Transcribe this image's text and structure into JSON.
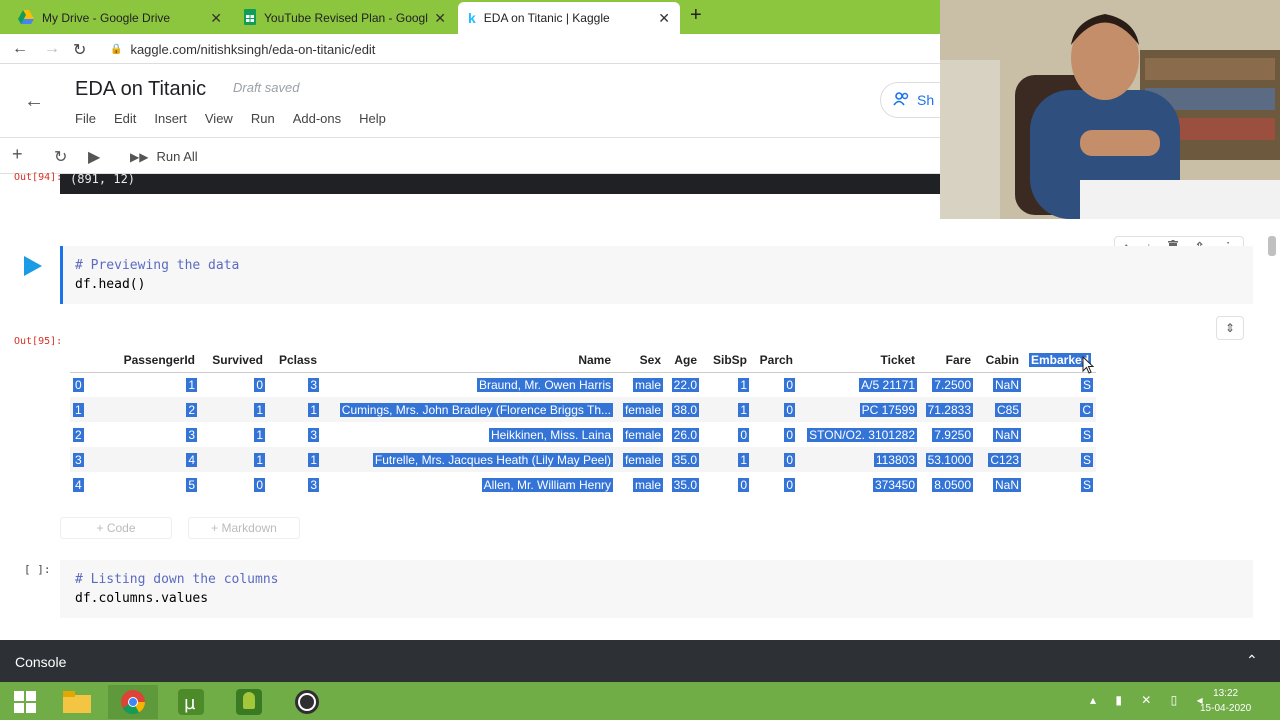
{
  "browser": {
    "tabs": [
      {
        "title": "My Drive - Google Drive",
        "icon": "google-drive-icon"
      },
      {
        "title": "YouTube Revised Plan - Google S",
        "icon": "google-sheets-icon"
      },
      {
        "title": "EDA on Titanic | Kaggle",
        "icon": "kaggle-icon"
      }
    ],
    "url": "kaggle.com/nitishksingh/eda-on-titanic/edit"
  },
  "notebook": {
    "title": "EDA on Titanic",
    "status": "Draft saved",
    "menu": [
      "File",
      "Edit",
      "Insert",
      "View",
      "Run",
      "Add-ons",
      "Help"
    ],
    "share_label": "Sh",
    "run_all_label": "Run All"
  },
  "prev_output": {
    "label": "Out[94]:",
    "text": "(891, 12)"
  },
  "cell1": {
    "comment": "# Previewing the data",
    "code": "df.head()",
    "out_label": "Out[95]:"
  },
  "dataframe": {
    "columns": [
      "",
      "PassengerId",
      "Survived",
      "Pclass",
      "Name",
      "Sex",
      "Age",
      "SibSp",
      "Parch",
      "Ticket",
      "Fare",
      "Cabin",
      "Embarked"
    ],
    "rows": [
      [
        "0",
        "1",
        "0",
        "3",
        "Braund, Mr. Owen Harris",
        "male",
        "22.0",
        "1",
        "0",
        "A/5 21171",
        "7.2500",
        "NaN",
        "S"
      ],
      [
        "1",
        "2",
        "1",
        "1",
        "Cumings, Mrs. John Bradley (Florence Briggs Th...",
        "female",
        "38.0",
        "1",
        "0",
        "PC 17599",
        "71.2833",
        "C85",
        "C"
      ],
      [
        "2",
        "3",
        "1",
        "3",
        "Heikkinen, Miss. Laina",
        "female",
        "26.0",
        "0",
        "0",
        "STON/O2. 3101282",
        "7.9250",
        "NaN",
        "S"
      ],
      [
        "3",
        "4",
        "1",
        "1",
        "Futrelle, Mrs. Jacques Heath (Lily May Peel)",
        "female",
        "35.0",
        "1",
        "0",
        "113803",
        "53.1000",
        "C123",
        "S"
      ],
      [
        "4",
        "5",
        "0",
        "3",
        "Allen, Mr. William Henry",
        "male",
        "35.0",
        "0",
        "0",
        "373450",
        "8.0500",
        "NaN",
        "S"
      ]
    ]
  },
  "add_buttons": {
    "code": "+ Code",
    "markdown": "+ Markdown"
  },
  "cell2": {
    "label": "[ ]:",
    "comment": "# Listing down the columns",
    "code": "df.columns.values"
  },
  "console": {
    "label": "Console"
  },
  "clock": {
    "time": "13:22",
    "date": "15-04-2020"
  },
  "colors": {
    "tabbar": "#8cc63f",
    "taskbar": "#70ad47",
    "selection": "#3374d6",
    "run_button": "#1a9be6"
  }
}
